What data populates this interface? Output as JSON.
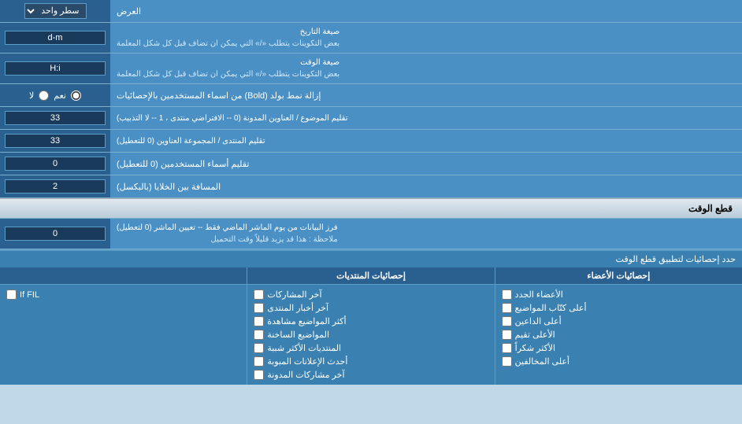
{
  "header": {
    "title": "العرض",
    "dropdown_label": "سطر واحد"
  },
  "rows": [
    {
      "label": "صيغة التاريخ\nبعض التكوينات يتطلب «/» التي يمكن ان تضاف قبل كل شكل المعلمة",
      "input_value": "d-m",
      "input_type": "text"
    },
    {
      "label": "صيغة الوقت\nبعض التكوينات يتطلب «/» التي يمكن ان تضاف قبل كل شكل المعلمة",
      "input_value": "H:i",
      "input_type": "text"
    },
    {
      "label": "إزالة نمط بولد (Bold) من اسماء المستخدمين بالإحصائيات",
      "input_type": "radio",
      "radio_options": [
        "نعم",
        "لا"
      ],
      "radio_selected": "نعم"
    },
    {
      "label": "تقليم الموضوع / العناوين المدونة (0 -- الافتراضي منتدى ، 1 -- لا التذبيب)",
      "input_value": "33",
      "input_type": "text"
    },
    {
      "label": "تقليم المنتدى / المجموعة العناوين (0 للتعطيل)",
      "input_value": "33",
      "input_type": "text"
    },
    {
      "label": "تقليم أسماء المستخدمين (0 للتعطيل)",
      "input_value": "0",
      "input_type": "text"
    },
    {
      "label": "المسافة بين الخلايا (بالبكسل)",
      "input_value": "2",
      "input_type": "text"
    }
  ],
  "section_realtime": {
    "title": "قطع الوقت",
    "row_label": "فرز البيانات من يوم الماشر الماضي فقط -- تعيين الماشر (0 لتعطيل)\nملاحظة : هذا قد يزيد قليلاً وقت التحميل",
    "row_value": "0"
  },
  "limit_row": {
    "label": "حدد إحصائيات لتطبيق قطع الوقت"
  },
  "columns": [
    {
      "header": "إحصائيات الأعضاء",
      "items": [
        "الأعضاء الجدد",
        "أعلى كتّاب المواضيع",
        "أعلى الداعين",
        "الأعلى تقيم",
        "الأكثر شكراً",
        "أعلى المخالفين"
      ]
    },
    {
      "header": "إحصائيات المنتديات",
      "items": [
        "آخر المشاركات",
        "آخر أخبار المنتدى",
        "أكثر المواضيع مشاهدة",
        "المواضيع الساخنة",
        "المنتديات الأكثر شببة",
        "أحدث الإعلانات المبوبة",
        "آخر مشاركات المدونة"
      ]
    },
    {
      "header": "",
      "items": []
    }
  ]
}
